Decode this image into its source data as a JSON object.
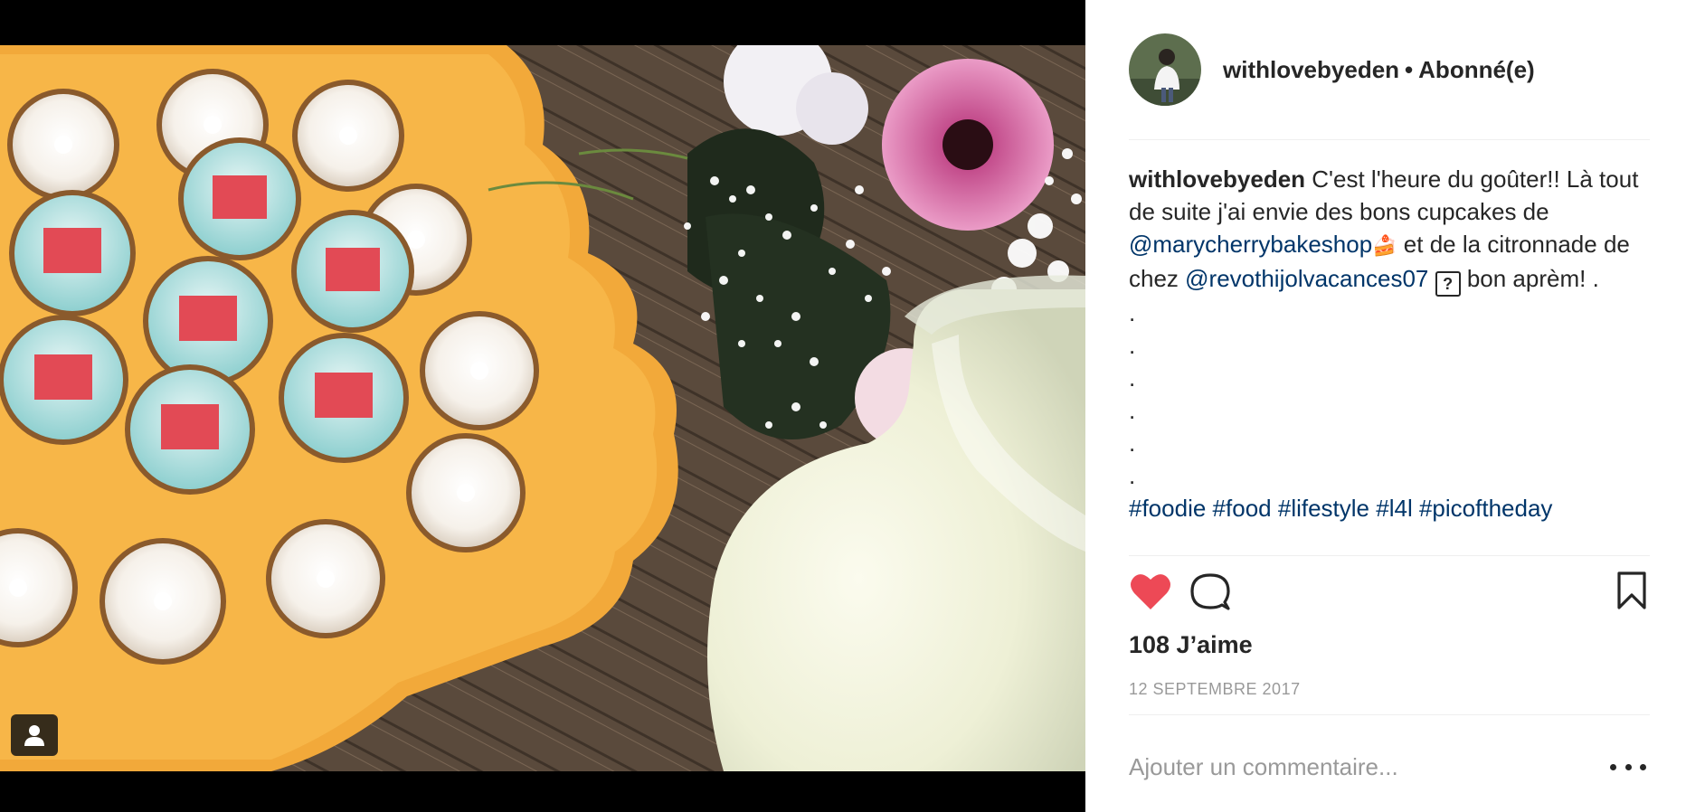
{
  "post": {
    "username": "withlovebyeden",
    "separator": "•",
    "follow_status": "Abonné(e)",
    "caption": {
      "user": "withlovebyeden",
      "text1": " C'est l'heure du goûter!! Là tout de suite j'ai envie des bons cupcakes de ",
      "mention1": "@marycherrybakeshop",
      "emoji1": "🍰",
      "text2": " et de la citronnade de chez ",
      "mention2": "@revothijolvacances07",
      "unknown_glyph": "?",
      "text3": " bon aprèm! .",
      "dots": [
        ".",
        ".",
        ".",
        ".",
        ".",
        "."
      ],
      "hashtags": [
        "#foodie",
        "#food",
        "#lifestyle",
        "#l4l",
        "#picoftheday"
      ]
    },
    "likes_label": "108 J’aime",
    "date": "12 SEPTEMBRE 2017",
    "comment_placeholder": "Ajouter un commentaire...",
    "liked": true,
    "like_color": "#ed4956"
  },
  "icons": {
    "tag": "user-tag-icon",
    "like": "heart-icon",
    "comment": "comment-icon",
    "save": "bookmark-icon",
    "more": "more-options-icon"
  }
}
